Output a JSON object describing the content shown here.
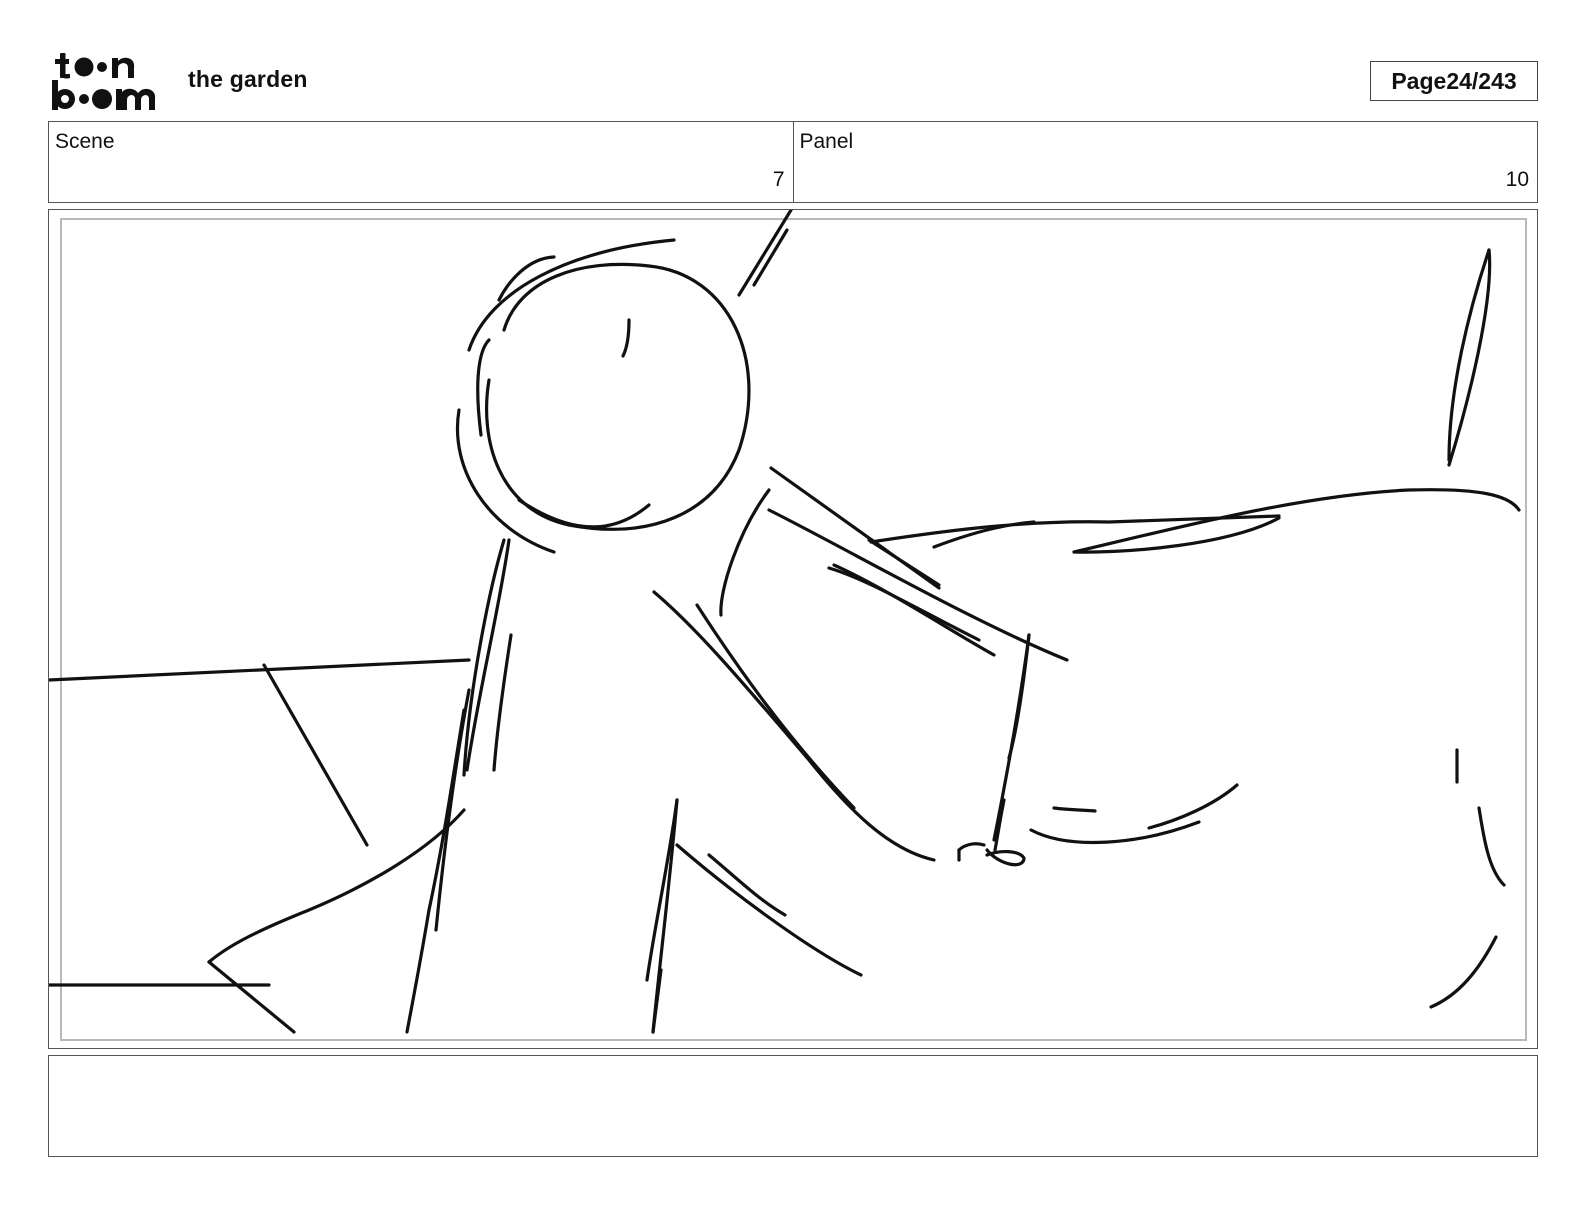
{
  "header": {
    "logo_text": "toon boom",
    "project_title": "the garden",
    "page_label": "Page",
    "page_number": "24/243"
  },
  "info": {
    "scene_label": "Scene",
    "scene_value": "7",
    "panel_label": "Panel",
    "panel_value": "10"
  },
  "sketch": {
    "description_icon": "storyboard-sketch-drawing",
    "stroke_color": "#111111",
    "frame_border_color": "#b9b9b9"
  },
  "notes": {
    "text": ""
  }
}
